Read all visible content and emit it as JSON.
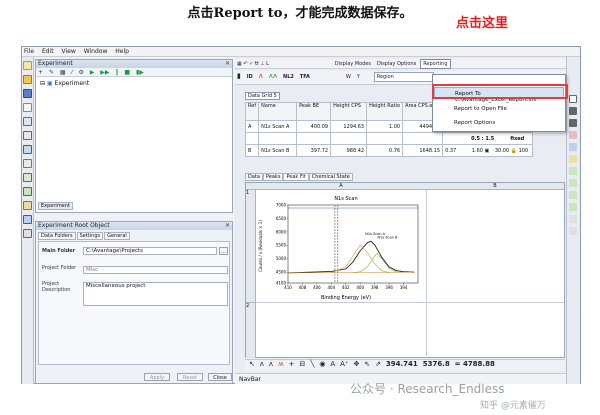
{
  "top_title": "点击Report to，才能完成数据保存。",
  "callout": "点击这里",
  "menubar": [
    "File",
    "Edit",
    "View",
    "Window",
    "Help"
  ],
  "experiment_panel": {
    "title": "Experiment",
    "tree_item": "Experiment",
    "tab": "Experiment"
  },
  "root_panel": {
    "title": "Experiment Root Object",
    "tabs": [
      "Data Folders",
      "Settings",
      "General"
    ],
    "main_folder_label": "Main Folder",
    "main_folder_value": "C:\\Avantage\\Projects",
    "project_folder_label": "Project Folder",
    "project_folder_value": "Misc",
    "project_desc_label": "Project Description",
    "project_desc_value": "Miscellaneous project",
    "buttons": {
      "apply": "Apply",
      "reset": "Reset",
      "close": "Close"
    }
  },
  "toolbar": {
    "display_modes": "Display Modes",
    "display_options": "Display Options",
    "reporting": "Reporting",
    "region": "Region",
    "row2_icons": [
      "ID",
      "NL2",
      "TFA"
    ]
  },
  "grid_tab": "Data Grid 5",
  "peak_table": {
    "headers": [
      "Ref",
      "Name",
      "Peak BE",
      "Height CPS",
      "Height Ratio",
      "Area CPS.eV"
    ],
    "rows": [
      [
        "A",
        "N1s Scan A",
        "400.09",
        "1294.63",
        "1.00",
        "4494.38"
      ],
      [
        "B",
        "N1s Scan B",
        "397.72",
        "988.42",
        "0.76",
        "1648.15"
      ]
    ],
    "extra_b": [
      "0.37",
      "1.60",
      "30.00",
      "100"
    ],
    "range": "0.5 : 1.5",
    "fixed": "fixed"
  },
  "subtabs": [
    "Data",
    "Peaks",
    "Peak Fit",
    "Chemical State"
  ],
  "sheet": {
    "col_a": "A",
    "col_b": "B",
    "row1": "1",
    "row2": "2"
  },
  "readout": {
    "x": "394.741",
    "y": "5376.8",
    "eq": "= 4788.88"
  },
  "navbar": "NavBar",
  "context_menu": [
    "Report To C:\\Avantage_Excel_Report.xls",
    "Report to Open File",
    "Report Options"
  ],
  "watermark": "公众号 · Research_Endless",
  "watermark2": "知乎 @元素催万",
  "chart_data": {
    "type": "line",
    "title": "N1s Scan",
    "xlabel": "Binding Energy (eV)",
    "ylabel": "Counts / s  (Residuals × 1)",
    "xlim": [
      410,
      392
    ],
    "ylim": [
      4100,
      7000
    ],
    "x_ticks": [
      "410",
      "408",
      "406",
      "404",
      "402",
      "400",
      "398",
      "396",
      "394"
    ],
    "y_ticks": [
      "4100",
      "4500",
      "5000",
      "5500",
      "6000",
      "6500",
      "7000"
    ],
    "peak_labels": [
      "N1s Scan A",
      "N1s Scan B"
    ],
    "series": [
      {
        "name": "envelope",
        "x": [
          410,
          408,
          406,
          404,
          402,
          401,
          400,
          399,
          398.5,
          398,
          397,
          396,
          395,
          394,
          392.5
        ],
        "y": [
          4480,
          4490,
          4510,
          4530,
          4620,
          4880,
          5300,
          5600,
          5650,
          5520,
          5050,
          4700,
          4560,
          4520,
          4500
        ]
      },
      {
        "name": "N1s Scan A",
        "x": [
          404,
          402,
          401,
          400,
          399,
          398,
          397,
          396
        ],
        "y": [
          4480,
          4700,
          5100,
          5520,
          5230,
          4820,
          4560,
          4480
        ]
      },
      {
        "name": "N1s Scan B",
        "x": [
          401,
          400,
          399,
          398,
          397.7,
          397,
          396,
          395
        ],
        "y": [
          4480,
          4520,
          4700,
          5100,
          5200,
          5000,
          4650,
          4500
        ]
      }
    ]
  }
}
